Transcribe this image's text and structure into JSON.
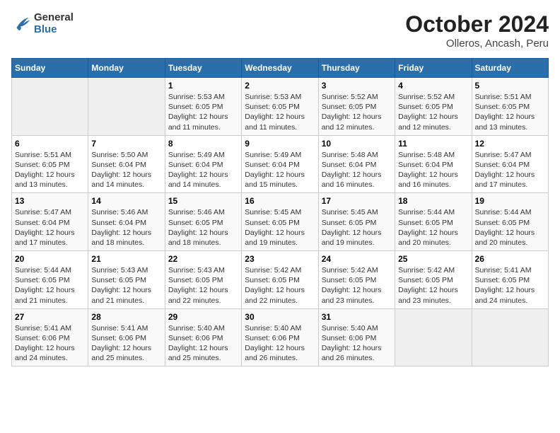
{
  "header": {
    "logo_general": "General",
    "logo_blue": "Blue",
    "month_title": "October 2024",
    "location": "Olleros, Ancash, Peru"
  },
  "days_of_week": [
    "Sunday",
    "Monday",
    "Tuesday",
    "Wednesday",
    "Thursday",
    "Friday",
    "Saturday"
  ],
  "weeks": [
    [
      {
        "day": "",
        "info": ""
      },
      {
        "day": "",
        "info": ""
      },
      {
        "day": "1",
        "info": "Sunrise: 5:53 AM\nSunset: 6:05 PM\nDaylight: 12 hours\nand 11 minutes."
      },
      {
        "day": "2",
        "info": "Sunrise: 5:53 AM\nSunset: 6:05 PM\nDaylight: 12 hours\nand 11 minutes."
      },
      {
        "day": "3",
        "info": "Sunrise: 5:52 AM\nSunset: 6:05 PM\nDaylight: 12 hours\nand 12 minutes."
      },
      {
        "day": "4",
        "info": "Sunrise: 5:52 AM\nSunset: 6:05 PM\nDaylight: 12 hours\nand 12 minutes."
      },
      {
        "day": "5",
        "info": "Sunrise: 5:51 AM\nSunset: 6:05 PM\nDaylight: 12 hours\nand 13 minutes."
      }
    ],
    [
      {
        "day": "6",
        "info": "Sunrise: 5:51 AM\nSunset: 6:05 PM\nDaylight: 12 hours\nand 13 minutes."
      },
      {
        "day": "7",
        "info": "Sunrise: 5:50 AM\nSunset: 6:04 PM\nDaylight: 12 hours\nand 14 minutes."
      },
      {
        "day": "8",
        "info": "Sunrise: 5:49 AM\nSunset: 6:04 PM\nDaylight: 12 hours\nand 14 minutes."
      },
      {
        "day": "9",
        "info": "Sunrise: 5:49 AM\nSunset: 6:04 PM\nDaylight: 12 hours\nand 15 minutes."
      },
      {
        "day": "10",
        "info": "Sunrise: 5:48 AM\nSunset: 6:04 PM\nDaylight: 12 hours\nand 16 minutes."
      },
      {
        "day": "11",
        "info": "Sunrise: 5:48 AM\nSunset: 6:04 PM\nDaylight: 12 hours\nand 16 minutes."
      },
      {
        "day": "12",
        "info": "Sunrise: 5:47 AM\nSunset: 6:04 PM\nDaylight: 12 hours\nand 17 minutes."
      }
    ],
    [
      {
        "day": "13",
        "info": "Sunrise: 5:47 AM\nSunset: 6:04 PM\nDaylight: 12 hours\nand 17 minutes."
      },
      {
        "day": "14",
        "info": "Sunrise: 5:46 AM\nSunset: 6:04 PM\nDaylight: 12 hours\nand 18 minutes."
      },
      {
        "day": "15",
        "info": "Sunrise: 5:46 AM\nSunset: 6:05 PM\nDaylight: 12 hours\nand 18 minutes."
      },
      {
        "day": "16",
        "info": "Sunrise: 5:45 AM\nSunset: 6:05 PM\nDaylight: 12 hours\nand 19 minutes."
      },
      {
        "day": "17",
        "info": "Sunrise: 5:45 AM\nSunset: 6:05 PM\nDaylight: 12 hours\nand 19 minutes."
      },
      {
        "day": "18",
        "info": "Sunrise: 5:44 AM\nSunset: 6:05 PM\nDaylight: 12 hours\nand 20 minutes."
      },
      {
        "day": "19",
        "info": "Sunrise: 5:44 AM\nSunset: 6:05 PM\nDaylight: 12 hours\nand 20 minutes."
      }
    ],
    [
      {
        "day": "20",
        "info": "Sunrise: 5:44 AM\nSunset: 6:05 PM\nDaylight: 12 hours\nand 21 minutes."
      },
      {
        "day": "21",
        "info": "Sunrise: 5:43 AM\nSunset: 6:05 PM\nDaylight: 12 hours\nand 21 minutes."
      },
      {
        "day": "22",
        "info": "Sunrise: 5:43 AM\nSunset: 6:05 PM\nDaylight: 12 hours\nand 22 minutes."
      },
      {
        "day": "23",
        "info": "Sunrise: 5:42 AM\nSunset: 6:05 PM\nDaylight: 12 hours\nand 22 minutes."
      },
      {
        "day": "24",
        "info": "Sunrise: 5:42 AM\nSunset: 6:05 PM\nDaylight: 12 hours\nand 23 minutes."
      },
      {
        "day": "25",
        "info": "Sunrise: 5:42 AM\nSunset: 6:05 PM\nDaylight: 12 hours\nand 23 minutes."
      },
      {
        "day": "26",
        "info": "Sunrise: 5:41 AM\nSunset: 6:05 PM\nDaylight: 12 hours\nand 24 minutes."
      }
    ],
    [
      {
        "day": "27",
        "info": "Sunrise: 5:41 AM\nSunset: 6:06 PM\nDaylight: 12 hours\nand 24 minutes."
      },
      {
        "day": "28",
        "info": "Sunrise: 5:41 AM\nSunset: 6:06 PM\nDaylight: 12 hours\nand 25 minutes."
      },
      {
        "day": "29",
        "info": "Sunrise: 5:40 AM\nSunset: 6:06 PM\nDaylight: 12 hours\nand 25 minutes."
      },
      {
        "day": "30",
        "info": "Sunrise: 5:40 AM\nSunset: 6:06 PM\nDaylight: 12 hours\nand 26 minutes."
      },
      {
        "day": "31",
        "info": "Sunrise: 5:40 AM\nSunset: 6:06 PM\nDaylight: 12 hours\nand 26 minutes."
      },
      {
        "day": "",
        "info": ""
      },
      {
        "day": "",
        "info": ""
      }
    ]
  ]
}
